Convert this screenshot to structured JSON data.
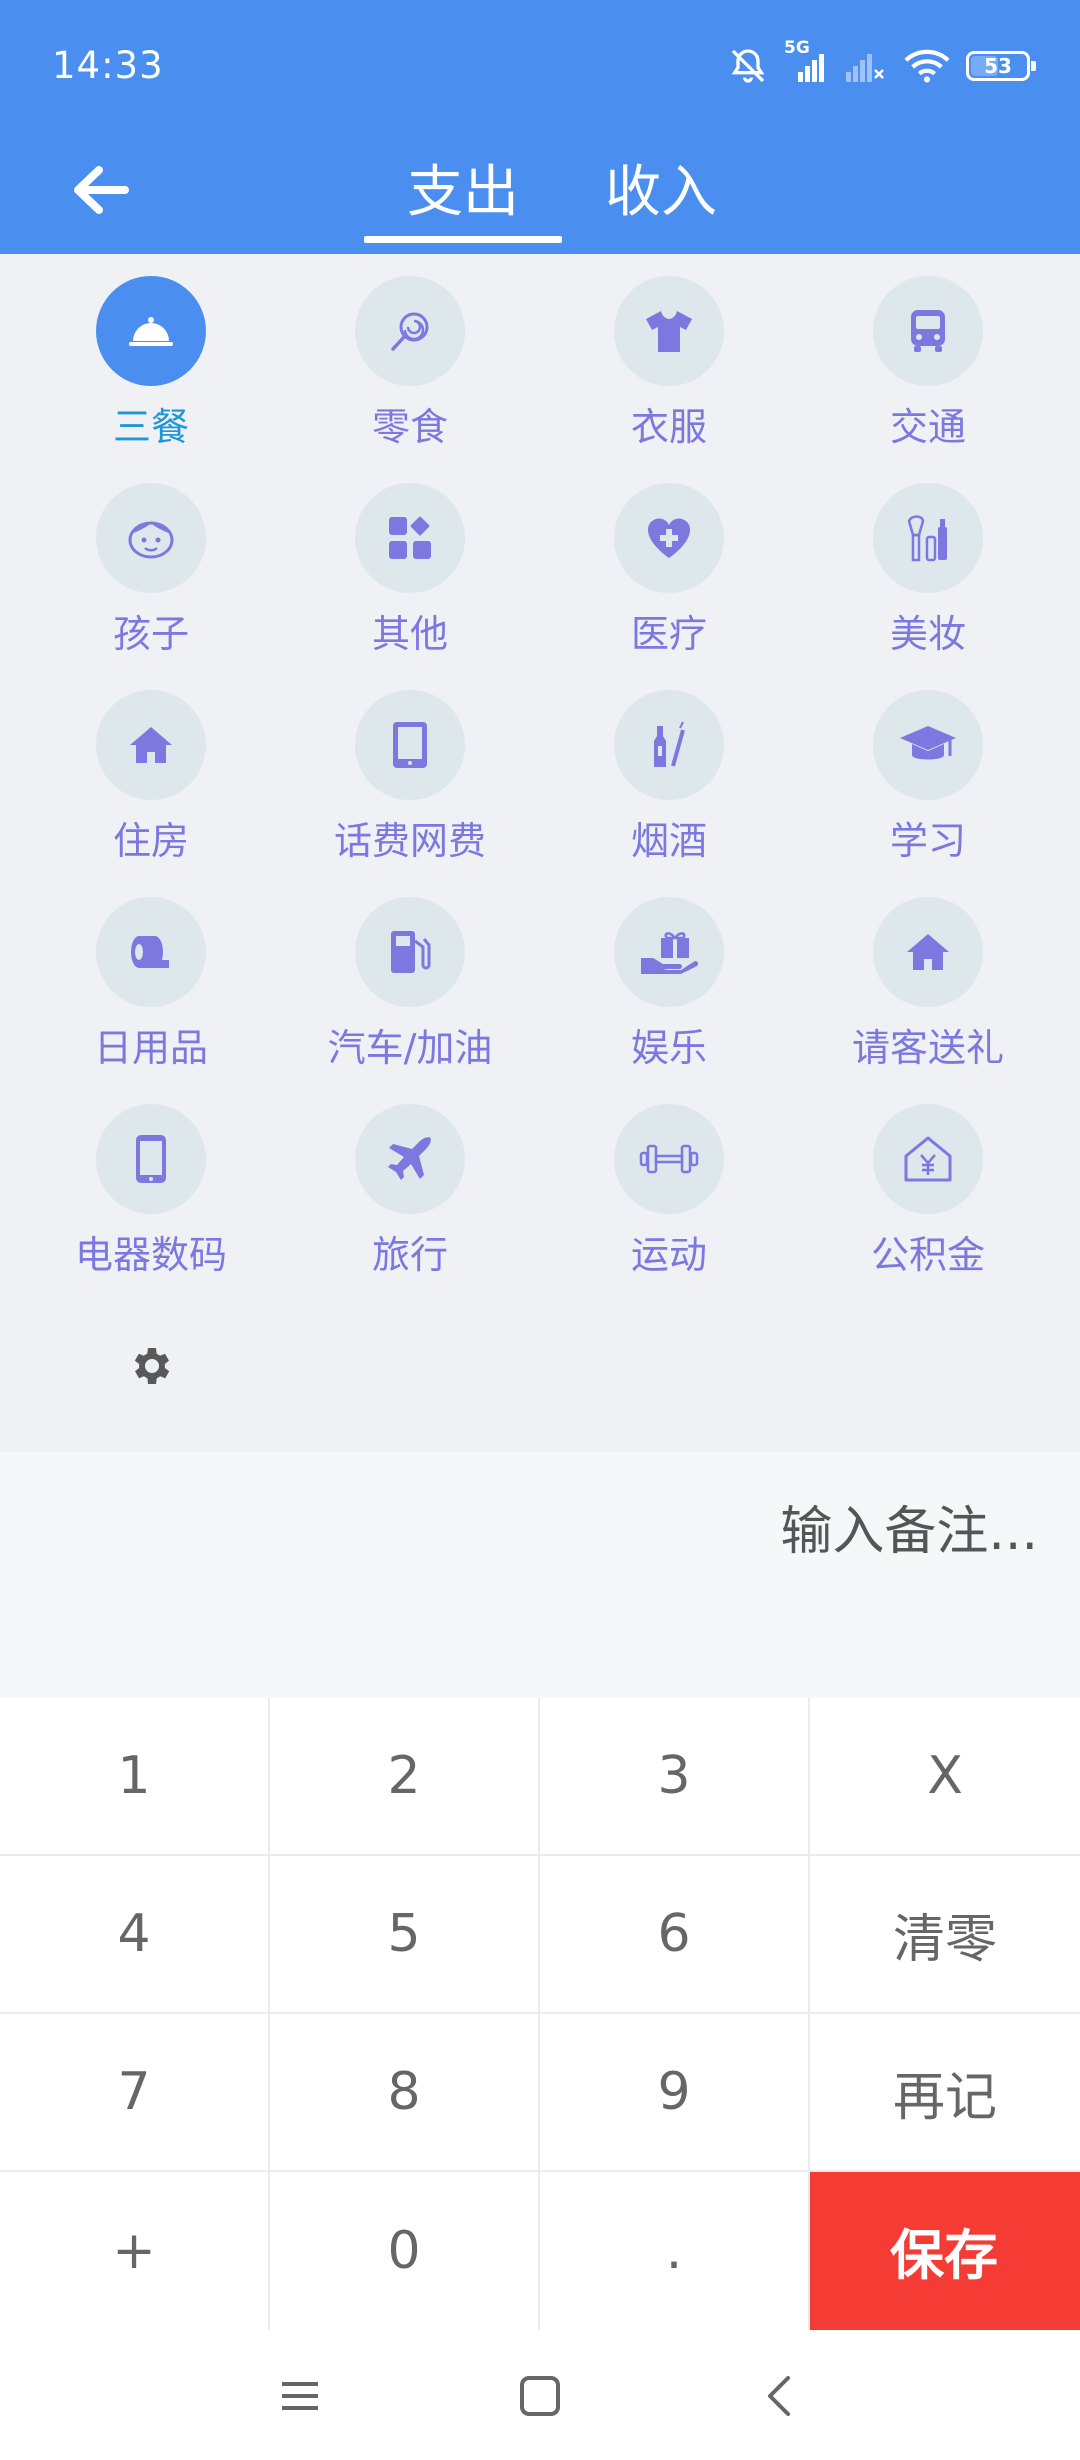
{
  "status_bar": {
    "time": "14:33",
    "network": "5G",
    "battery": "53",
    "battery_level": 0.53
  },
  "nav": {
    "tabs": [
      {
        "label": "支出",
        "active": true
      },
      {
        "label": "收入",
        "active": false
      }
    ]
  },
  "categories": [
    {
      "label": "三餐",
      "icon": "cloche-icon",
      "selected": true
    },
    {
      "label": "零食",
      "icon": "lollipop-icon"
    },
    {
      "label": "衣服",
      "icon": "tshirt-icon"
    },
    {
      "label": "交通",
      "icon": "bus-icon"
    },
    {
      "label": "孩子",
      "icon": "child-face-icon"
    },
    {
      "label": "其他",
      "icon": "apps-icon"
    },
    {
      "label": "医疗",
      "icon": "heart-cross-icon"
    },
    {
      "label": "美妆",
      "icon": "makeup-icon"
    },
    {
      "label": "住房",
      "icon": "house-icon"
    },
    {
      "label": "话费网费",
      "icon": "tablet-icon"
    },
    {
      "label": "烟酒",
      "icon": "bottle-cigarette-icon"
    },
    {
      "label": "学习",
      "icon": "graduation-cap-icon"
    },
    {
      "label": "日用品",
      "icon": "toilet-paper-icon"
    },
    {
      "label": "汽车/加油",
      "icon": "gas-pump-icon"
    },
    {
      "label": "娱乐",
      "icon": "gift-hand-icon"
    },
    {
      "label": "请客送礼",
      "icon": "house-icon"
    },
    {
      "label": "电器数码",
      "icon": "phone-icon"
    },
    {
      "label": "旅行",
      "icon": "airplane-icon"
    },
    {
      "label": "运动",
      "icon": "dumbbell-icon"
    },
    {
      "label": "公积金",
      "icon": "house-yuan-icon"
    }
  ],
  "note": {
    "placeholder": "输入备注..."
  },
  "keypad": {
    "keys": [
      "1",
      "2",
      "3",
      "X",
      "4",
      "5",
      "6",
      "清零",
      "7",
      "8",
      "9",
      "再记",
      "+",
      "0",
      ".",
      "保存"
    ]
  },
  "colors": {
    "primary": "#4a8ff0",
    "category_text": "#7c78e0",
    "selected_text": "#1e96d8",
    "circle_bg": "#dde7ec",
    "save": "#f43b34"
  }
}
